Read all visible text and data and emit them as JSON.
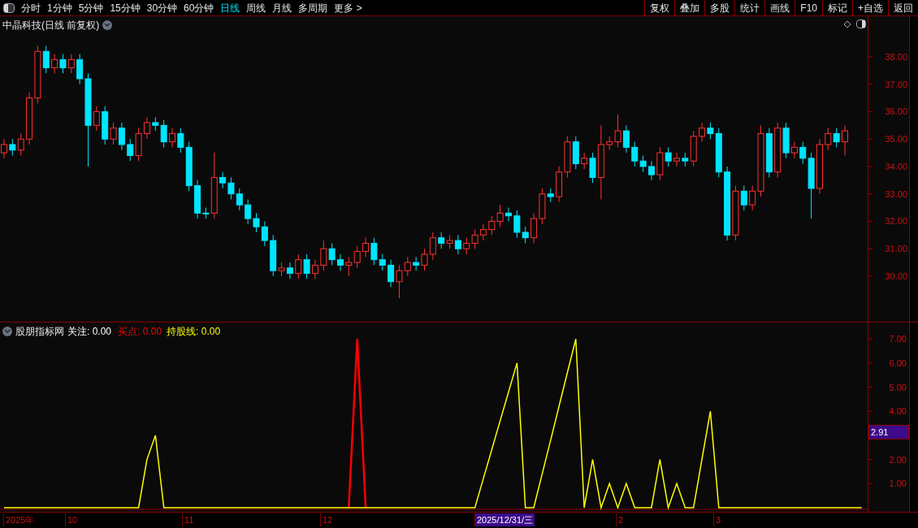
{
  "toolbar": {
    "tabs": [
      {
        "label": "分时",
        "selected": false
      },
      {
        "label": "1分钟",
        "selected": false
      },
      {
        "label": "5分钟",
        "selected": false
      },
      {
        "label": "15分钟",
        "selected": false
      },
      {
        "label": "30分钟",
        "selected": false
      },
      {
        "label": "60分钟",
        "selected": false
      },
      {
        "label": "日线",
        "selected": true
      },
      {
        "label": "周线",
        "selected": false
      },
      {
        "label": "月线",
        "selected": false
      },
      {
        "label": "多周期",
        "selected": false
      }
    ],
    "more": "更多 >",
    "buttons": [
      "复权",
      "叠加",
      "多股",
      "统计",
      "画线",
      "F10",
      "标记",
      "+自选",
      "返回"
    ]
  },
  "main_chart": {
    "title": "中晶科技(日线 前复权)",
    "chart_data": {
      "type": "candlestick",
      "categories": [
        null,
        null,
        null,
        null,
        null,
        null,
        null,
        null,
        null,
        null,
        null,
        null,
        null,
        null,
        null,
        null,
        null,
        null,
        null,
        null,
        null,
        null,
        null,
        null,
        null,
        null,
        null,
        null,
        null,
        null,
        null,
        null,
        null,
        null,
        null,
        null,
        null,
        null,
        null,
        null,
        null,
        null,
        null,
        null,
        null,
        null,
        null,
        null,
        null,
        null,
        null,
        null,
        null,
        null,
        null,
        null,
        null,
        null,
        null,
        null,
        null,
        null,
        null,
        null,
        null,
        null,
        null,
        null,
        null,
        null,
        null,
        null,
        null,
        null,
        null,
        null,
        null,
        null,
        null,
        null,
        null,
        null,
        null,
        null,
        null,
        null,
        null,
        null,
        null,
        null,
        null,
        null,
        null,
        null,
        null,
        null,
        null,
        null,
        null,
        null,
        null
      ],
      "ylim": [
        28.34,
        39.48
      ],
      "yticks": [
        {
          "value": 38,
          "label": "38.00"
        },
        {
          "value": 37,
          "label": "37.00"
        },
        {
          "value": 36,
          "label": "36.00"
        },
        {
          "value": 35,
          "label": "35.00"
        },
        {
          "value": 34,
          "label": "34.00"
        },
        {
          "value": 33,
          "label": "33.00"
        },
        {
          "value": 32,
          "label": "32.00"
        },
        {
          "value": 31,
          "label": "31.00"
        },
        {
          "value": 30,
          "label": "30.00"
        }
      ],
      "ohlc": [
        [
          34.5,
          35.0,
          34.3,
          34.8
        ],
        [
          34.8,
          35.0,
          34.4,
          34.6
        ],
        [
          34.6,
          35.2,
          34.4,
          35.0
        ],
        [
          35.0,
          36.7,
          34.8,
          36.5
        ],
        [
          36.5,
          38.4,
          36.3,
          38.2
        ],
        [
          38.2,
          38.4,
          37.4,
          37.6
        ],
        [
          37.6,
          38.1,
          37.4,
          37.9
        ],
        [
          37.9,
          38.1,
          37.4,
          37.6
        ],
        [
          37.6,
          38.1,
          37.4,
          37.9
        ],
        [
          37.9,
          38.1,
          37.0,
          37.2
        ],
        [
          37.2,
          37.4,
          34.0,
          35.5
        ],
        [
          35.5,
          36.2,
          35.3,
          36.0
        ],
        [
          36.0,
          36.2,
          34.8,
          35.0
        ],
        [
          35.0,
          35.6,
          34.8,
          35.4
        ],
        [
          35.4,
          35.6,
          34.6,
          34.8
        ],
        [
          34.8,
          35.0,
          34.2,
          34.4
        ],
        [
          34.4,
          35.4,
          34.2,
          35.2
        ],
        [
          35.2,
          35.8,
          35.0,
          35.6
        ],
        [
          35.6,
          35.8,
          35.3,
          35.5
        ],
        [
          35.5,
          35.7,
          34.7,
          34.9
        ],
        [
          34.9,
          35.4,
          34.7,
          35.2
        ],
        [
          35.2,
          35.4,
          34.5,
          34.7
        ],
        [
          34.7,
          34.9,
          33.1,
          33.3
        ],
        [
          33.3,
          33.5,
          32.1,
          32.3
        ],
        [
          32.3,
          32.5,
          32.1,
          32.3
        ],
        [
          32.3,
          34.5,
          32.1,
          33.6
        ],
        [
          33.6,
          33.8,
          33.2,
          33.4
        ],
        [
          33.4,
          33.6,
          32.8,
          33.0
        ],
        [
          33.0,
          33.2,
          32.4,
          32.6
        ],
        [
          32.6,
          32.8,
          31.9,
          32.1
        ],
        [
          32.1,
          32.3,
          31.6,
          31.8
        ],
        [
          31.8,
          32.0,
          31.1,
          31.3
        ],
        [
          31.3,
          31.5,
          30.0,
          30.2
        ],
        [
          30.2,
          30.5,
          30.0,
          30.3
        ],
        [
          30.3,
          30.5,
          29.9,
          30.1
        ],
        [
          30.1,
          30.8,
          29.9,
          30.6
        ],
        [
          30.6,
          30.8,
          29.9,
          30.1
        ],
        [
          30.1,
          30.6,
          29.9,
          30.4
        ],
        [
          30.4,
          31.3,
          30.2,
          31.0
        ],
        [
          31.0,
          31.2,
          30.4,
          30.6
        ],
        [
          30.6,
          30.8,
          30.2,
          30.4
        ],
        [
          30.4,
          30.7,
          30.0,
          30.5
        ],
        [
          30.5,
          31.1,
          30.3,
          30.9
        ],
        [
          30.9,
          31.4,
          30.7,
          31.2
        ],
        [
          31.2,
          31.4,
          30.4,
          30.6
        ],
        [
          30.6,
          30.8,
          30.2,
          30.4
        ],
        [
          30.4,
          30.6,
          29.6,
          29.8
        ],
        [
          29.8,
          30.4,
          29.2,
          30.2
        ],
        [
          30.2,
          30.7,
          30.0,
          30.5
        ],
        [
          30.5,
          30.7,
          30.2,
          30.4
        ],
        [
          30.4,
          31.0,
          30.2,
          30.8
        ],
        [
          30.8,
          31.6,
          30.6,
          31.4
        ],
        [
          31.4,
          31.6,
          31.0,
          31.2
        ],
        [
          31.2,
          31.5,
          31.0,
          31.3
        ],
        [
          31.3,
          31.5,
          30.8,
          31.0
        ],
        [
          31.0,
          31.4,
          30.8,
          31.2
        ],
        [
          31.2,
          31.7,
          31.0,
          31.5
        ],
        [
          31.5,
          31.9,
          31.3,
          31.7
        ],
        [
          31.7,
          32.2,
          31.5,
          32.0
        ],
        [
          32.0,
          32.6,
          31.8,
          32.3
        ],
        [
          32.3,
          32.5,
          32.0,
          32.2
        ],
        [
          32.2,
          32.4,
          31.4,
          31.6
        ],
        [
          31.6,
          31.8,
          31.2,
          31.4
        ],
        [
          31.4,
          32.3,
          31.2,
          32.1
        ],
        [
          32.1,
          33.2,
          31.9,
          33.0
        ],
        [
          33.0,
          33.2,
          32.7,
          32.9
        ],
        [
          32.9,
          34.0,
          32.7,
          33.8
        ],
        [
          33.8,
          35.1,
          33.6,
          34.9
        ],
        [
          34.9,
          35.1,
          33.9,
          34.1
        ],
        [
          34.1,
          34.5,
          33.9,
          34.3
        ],
        [
          34.3,
          34.5,
          33.4,
          33.6
        ],
        [
          33.6,
          35.5,
          32.8,
          34.8
        ],
        [
          34.8,
          35.1,
          34.6,
          34.9
        ],
        [
          34.9,
          35.9,
          34.7,
          35.3
        ],
        [
          35.3,
          35.5,
          34.5,
          34.7
        ],
        [
          34.7,
          34.9,
          34.0,
          34.2
        ],
        [
          34.2,
          34.4,
          33.8,
          34.0
        ],
        [
          34.0,
          34.2,
          33.5,
          33.7
        ],
        [
          33.7,
          34.7,
          33.5,
          34.5
        ],
        [
          34.5,
          34.7,
          34.0,
          34.2
        ],
        [
          34.2,
          34.5,
          34.0,
          34.3
        ],
        [
          34.3,
          34.5,
          34.0,
          34.2
        ],
        [
          34.2,
          35.3,
          34.0,
          35.1
        ],
        [
          35.1,
          35.6,
          34.9,
          35.4
        ],
        [
          35.4,
          35.6,
          35.0,
          35.2
        ],
        [
          35.2,
          35.4,
          33.6,
          33.8
        ],
        [
          33.8,
          34.0,
          31.3,
          31.5
        ],
        [
          31.5,
          33.3,
          31.3,
          33.1
        ],
        [
          33.1,
          33.3,
          32.4,
          32.6
        ],
        [
          32.6,
          33.3,
          32.4,
          33.1
        ],
        [
          33.1,
          35.5,
          32.9,
          35.2
        ],
        [
          35.2,
          35.4,
          33.6,
          33.8
        ],
        [
          33.8,
          35.6,
          33.6,
          35.4
        ],
        [
          35.4,
          35.6,
          34.3,
          34.5
        ],
        [
          34.5,
          34.9,
          34.3,
          34.7
        ],
        [
          34.7,
          34.9,
          34.1,
          34.3
        ],
        [
          34.3,
          34.5,
          32.1,
          33.2
        ],
        [
          33.2,
          35.0,
          33.0,
          34.8
        ],
        [
          34.8,
          35.4,
          34.6,
          35.2
        ],
        [
          35.2,
          35.4,
          34.7,
          34.9
        ],
        [
          34.9,
          35.5,
          34.4,
          35.3
        ]
      ]
    }
  },
  "indicator": {
    "name": "股朋指标网",
    "watch": {
      "label": "关注: 0.00",
      "color": "#ffffff"
    },
    "series_readings": [
      ": 0.00",
      ": 0.00"
    ],
    "cursor_value": "2.91",
    "chart_data": {
      "type": "line",
      "categories": [
        null,
        null,
        null,
        null,
        null,
        null,
        null,
        null,
        null,
        null,
        null,
        null,
        null,
        null,
        null,
        null,
        null,
        null,
        null,
        null,
        null,
        null,
        null,
        null,
        null,
        null,
        null,
        null,
        null,
        null,
        null,
        null,
        null,
        null,
        null,
        null,
        null,
        null,
        null,
        null,
        null,
        null,
        null,
        null,
        null,
        null,
        null,
        null,
        null,
        null,
        null,
        null,
        null,
        null,
        null,
        null,
        null,
        null,
        null,
        null,
        null,
        null,
        null,
        null,
        null,
        null,
        null,
        null,
        null,
        null,
        null,
        null,
        null,
        null,
        null,
        null,
        null,
        null,
        null,
        null,
        null,
        null,
        null,
        null,
        null,
        null,
        null,
        null,
        null,
        null,
        null,
        null,
        null,
        null,
        null,
        null,
        null,
        null,
        null,
        null,
        null,
        null,
        null
      ],
      "ylim": [
        0,
        7.68
      ],
      "yticks": [
        {
          "value": 1,
          "label": "1.00"
        },
        {
          "value": 2,
          "label": "2.00"
        },
        {
          "value": 4,
          "label": "4.00"
        },
        {
          "value": 5,
          "label": "5.00"
        },
        {
          "value": 6,
          "label": "6.00"
        },
        {
          "value": 7,
          "label": "7.00"
        }
      ],
      "series": [
        {
          "name": "买点",
          "color": "#ff0000",
          "values": [
            null,
            null,
            null,
            null,
            null,
            null,
            null,
            null,
            null,
            null,
            null,
            null,
            null,
            null,
            null,
            null,
            null,
            null,
            null,
            null,
            null,
            null,
            null,
            null,
            null,
            null,
            null,
            null,
            null,
            null,
            null,
            null,
            null,
            null,
            null,
            null,
            null,
            null,
            null,
            null,
            null,
            0,
            7,
            0,
            null,
            null,
            null,
            null,
            null,
            null,
            null,
            null,
            null,
            null,
            null,
            null,
            null,
            null,
            null,
            null,
            null,
            null,
            null,
            null,
            null,
            null,
            null,
            null,
            null,
            null,
            null,
            null,
            null,
            null,
            null,
            null,
            null,
            null,
            null,
            null,
            null,
            null,
            null,
            null,
            null,
            null,
            null,
            null,
            null,
            null,
            null,
            null,
            null,
            null,
            null,
            null,
            null,
            null,
            null,
            null,
            null,
            null,
            null
          ]
        },
        {
          "name": "持股线",
          "color": "#ffff00",
          "values": [
            0,
            0,
            0,
            0,
            0,
            0,
            0,
            0,
            0,
            0,
            0,
            0,
            0,
            0,
            0,
            0,
            0,
            2,
            3,
            0,
            0,
            0,
            0,
            0,
            0,
            0,
            0,
            0,
            0,
            0,
            0,
            0,
            0,
            0,
            0,
            0,
            0,
            0,
            0,
            0,
            0,
            0,
            0,
            0,
            0,
            0,
            0,
            0,
            0,
            0,
            0,
            0,
            0,
            0,
            0,
            0,
            0,
            1.2,
            2.4,
            3.6,
            4.8,
            6,
            0,
            0,
            1.4,
            2.8,
            4.2,
            5.6,
            7,
            0,
            2,
            0,
            1,
            0,
            1,
            0,
            0,
            0,
            2,
            0,
            1,
            0,
            0,
            2,
            4,
            0,
            0,
            0,
            0,
            0,
            0,
            0,
            0,
            0,
            0,
            0,
            0,
            0,
            0,
            0,
            0,
            0,
            0
          ]
        }
      ]
    }
  },
  "date_axis": [
    {
      "label": "2025年",
      "selected": false
    },
    {
      "label": "10",
      "selected": false
    },
    {
      "label": "11",
      "selected": false
    },
    {
      "label": "12",
      "selected": false
    },
    {
      "label": "2025/12/31/三",
      "selected": true
    },
    {
      "label": "2",
      "selected": false
    },
    {
      "label": "3",
      "selected": false
    }
  ]
}
